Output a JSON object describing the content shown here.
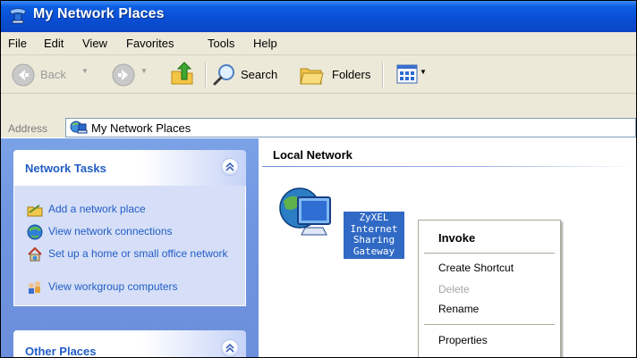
{
  "window": {
    "title": "My Network Places"
  },
  "menubar": {
    "items": [
      "File",
      "Edit",
      "View",
      "Favorites",
      "Tools",
      "Help"
    ]
  },
  "toolbar": {
    "back_label": "Back",
    "search_label": "Search",
    "folders_label": "Folders",
    "icons": [
      "back-arrow-icon",
      "forward-arrow-icon",
      "up-folder-icon",
      "search-magnifier-icon",
      "folders-icon",
      "views-grid-icon"
    ]
  },
  "address": {
    "label": "Address",
    "value": "My Network Places"
  },
  "taskpane": {
    "network_tasks": {
      "title": "Network Tasks",
      "items": [
        {
          "label": "Add a network place",
          "icon": "add-network-place-icon"
        },
        {
          "label": "View network connections",
          "icon": "network-connections-icon"
        },
        {
          "label": "Set up a home or small office network",
          "icon": "home-network-setup-icon"
        },
        {
          "label": "View workgroup computers",
          "icon": "workgroup-computers-icon"
        }
      ]
    },
    "other_places": {
      "title": "Other Places"
    }
  },
  "content": {
    "group_title": "Local Network",
    "item": {
      "label_lines": [
        "ZyXEL",
        "Internet",
        "Sharing",
        "Gateway"
      ],
      "icon": "internet-gateway-icon"
    }
  },
  "context_menu": {
    "items": [
      {
        "label": "Invoke",
        "bold": true,
        "enabled": true
      },
      {
        "label": "Create Shortcut",
        "enabled": true
      },
      {
        "label": "Delete",
        "enabled": false
      },
      {
        "label": "Rename",
        "enabled": true
      },
      {
        "label": "Properties",
        "enabled": true
      }
    ]
  },
  "colors": {
    "titlebar": "#0a4fd6",
    "taskpane": "#6f95e0",
    "task_link": "#215dc6",
    "selection": "#316ac5"
  }
}
